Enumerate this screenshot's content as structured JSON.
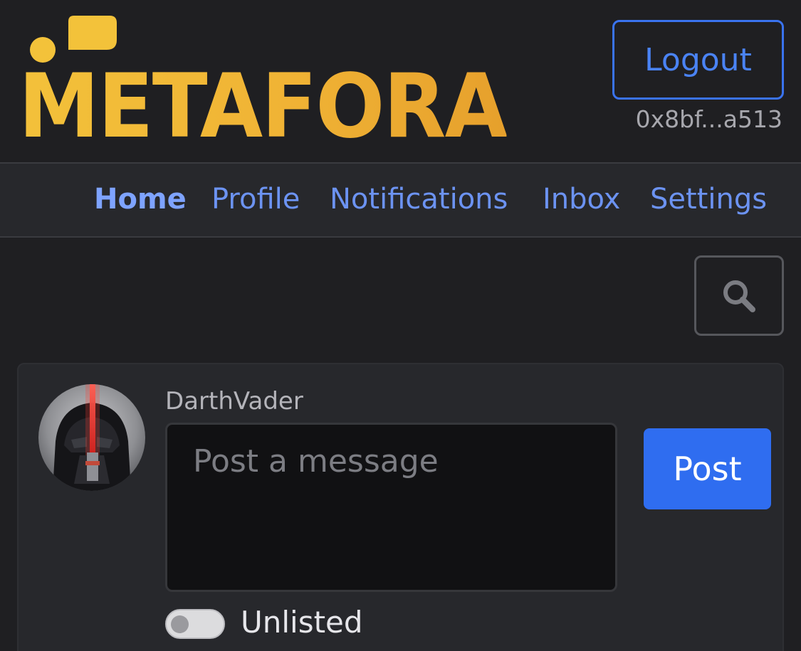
{
  "header": {
    "logo_text": "METAFORA",
    "logout_label": "Logout",
    "wallet_address": "0x8bf...a513"
  },
  "nav": {
    "items": [
      {
        "label": "Home",
        "active": true
      },
      {
        "label": "Profile",
        "active": false
      },
      {
        "label": "Notifications",
        "active": false
      },
      {
        "label": "Inbox",
        "active": false
      },
      {
        "label": "Settings",
        "active": false
      }
    ]
  },
  "search": {
    "icon": "search-icon"
  },
  "composer": {
    "username": "DarthVader",
    "placeholder": "Post a message",
    "value": "",
    "post_label": "Post",
    "unlisted_label": "Unlisted",
    "unlisted_on": false
  },
  "colors": {
    "background": "#1f1f22",
    "accent": "#2f6df0",
    "logo_gold": "#f0b335",
    "link": "#6c93f2"
  }
}
